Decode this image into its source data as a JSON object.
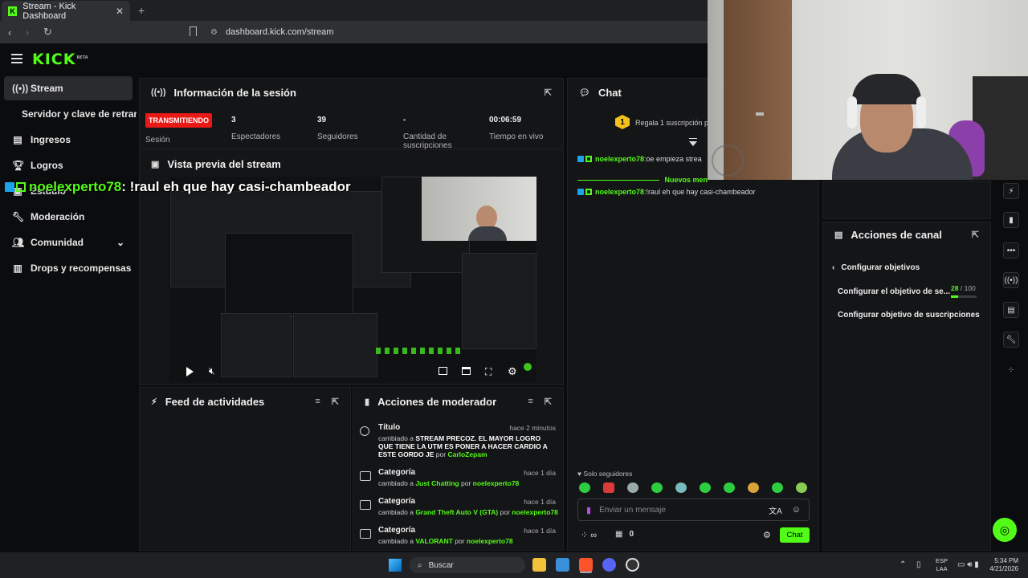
{
  "browser": {
    "tab_title": "Stream - Kick Dashboard",
    "tab_close": "✕",
    "new_tab": "+",
    "url": "dashboard.kick.com/stream"
  },
  "app": {
    "logo": "KICK",
    "logo_badge": "BETA"
  },
  "sidebar": {
    "items": [
      {
        "label": "Stream",
        "icon": "broadcast-icon"
      },
      {
        "label": "Servidor y clave de retransmisión",
        "icon": ""
      },
      {
        "label": "Ingresos",
        "icon": "chart-icon"
      },
      {
        "label": "Logros",
        "icon": "trophy-icon"
      },
      {
        "label": "Estudio",
        "icon": "studio-icon"
      },
      {
        "label": "Moderación",
        "icon": "wrench-icon"
      },
      {
        "label": "Comunidad",
        "icon": "users-icon"
      },
      {
        "label": "Drops y recompensas",
        "icon": "gift-icon"
      }
    ],
    "server_label": "Servidor y clave de retransmi"
  },
  "session": {
    "title": "Información de la sesión",
    "status": "TRANSMITIENDO",
    "status_sub": "Sesión",
    "stats": [
      {
        "value": "3",
        "label": "Espectadores"
      },
      {
        "value": "39",
        "label": "Seguidores"
      },
      {
        "value": "-",
        "label": "Cantidad de suscripciones"
      },
      {
        "value": "00:06:59",
        "label": "Tiempo en vivo"
      }
    ]
  },
  "preview": {
    "title": "Vista previa del stream"
  },
  "overlay": {
    "user": "noelexperto78",
    "text": " : !raul eh que hay casi-chambeador"
  },
  "activity_feed": {
    "title": "Feed de actividades"
  },
  "mod_actions": {
    "title": "Acciones de moderador",
    "items": [
      {
        "type": "Título",
        "ago": "hace 2 minutos",
        "pre": "cambiado a ",
        "value": "STREAM PRECOZ. EL MAYOR LOGRO QUE TIENE LA UTM ES PONER A HACER CARDIO A ESTE GORDO JE",
        "by": " por ",
        "user": "CarloZepam"
      },
      {
        "type": "Categoría",
        "ago": "hace 1 día",
        "pre": "cambiado a ",
        "value": "Just Chatting",
        "by": " por ",
        "user": "noelexperto78"
      },
      {
        "type": "Categoría",
        "ago": "hace 1 día",
        "pre": "cambiado a ",
        "value": "Grand Theft Auto V (GTA)",
        "by": " por ",
        "user": "noelexperto78"
      },
      {
        "type": "Categoría",
        "ago": "hace 1 día",
        "pre": "cambiado a ",
        "value": "VALORANT",
        "by": " por ",
        "user": "noelexperto78"
      }
    ]
  },
  "chat": {
    "title": "Chat",
    "gift_text": "Regala 1 suscripción pa",
    "gift_rank": "1",
    "messages": [
      {
        "user": "noelexperto78",
        "sep": ": ",
        "text": "oe empieza strea"
      },
      {
        "user": "noelexperto78",
        "sep": ": ",
        "text": "!raul eh que hay casi-chambeador"
      }
    ],
    "new_messages": "Nuevos men",
    "followers_only": "Solo seguidores",
    "input_placeholder": "Enviar un mensaje",
    "points": "0",
    "send_label": "Chat"
  },
  "channel_actions": {
    "title": "Acciones de canal",
    "back_label": "Configurar objetivos",
    "goal1": "Configurar el objetivo de se...",
    "goal1_progress": "28",
    "goal1_sep": " / ",
    "goal1_total": "100",
    "goal2": "Configurar objetivo de suscripciones"
  },
  "taskbar": {
    "search": "Buscar",
    "lang1": "ESP",
    "lang2": "LAA",
    "time": "5:34 PM",
    "date": "4/21/2026"
  },
  "colors": {
    "accent": "#53fc18",
    "live": "#e91916",
    "panel": "#141517"
  }
}
